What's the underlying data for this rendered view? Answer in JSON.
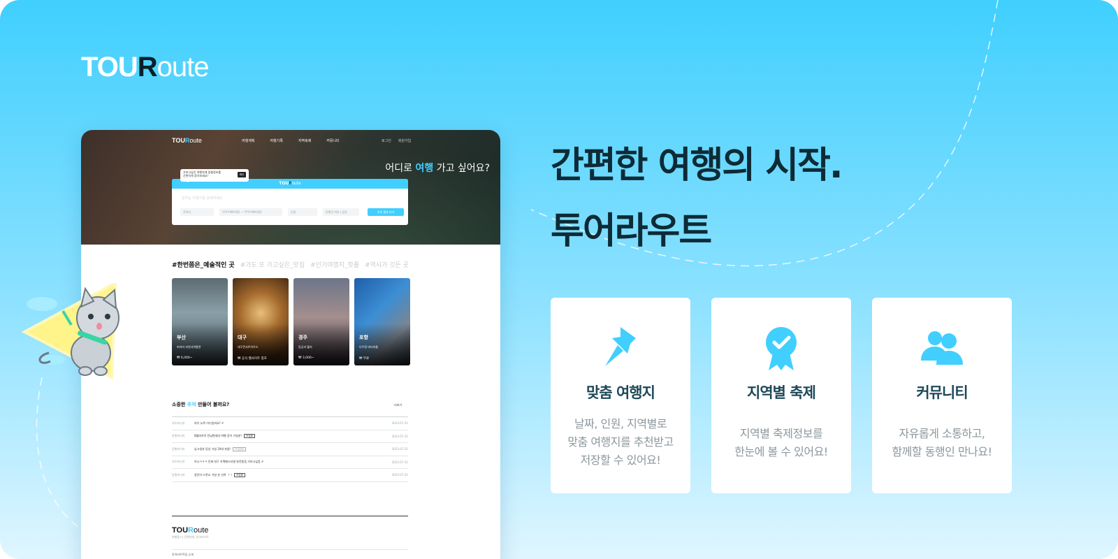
{
  "brand": {
    "tour": "TOU",
    "r": "R",
    "rest": "oute"
  },
  "mockup": {
    "nav": [
      "여행계획",
      "여행기록",
      "지역축제",
      "커뮤니티"
    ],
    "auth": [
      "로그인",
      "회원가입"
    ],
    "question": {
      "pre": "어디로 ",
      "highlight": "여행",
      "post": " 가고 싶어요?"
    },
    "tooltip": {
      "line1": "가보고싶은 여행지에 맞춤정보를",
      "line2": "간편하게 찾아보세요!",
      "close": "확인"
    },
    "search": {
      "placeholder": "원하는 여행지를 검색하세요",
      "fields": [
        "목적지",
        "YYYY-MM-DD ~ YYYY-MM-DD",
        "인원",
        "동행인 여부 | 없음"
      ],
      "button": "추천 결과 보기"
    },
    "tags": [
      "#한번쯤은_예술적인 곳",
      "#가도 또 가고싶은_맛집",
      "#인기여행지_핫플",
      "#역사가 깃든 곳"
    ],
    "cards": [
      {
        "city": "부산",
        "place": "피라미 자연사박물관",
        "price": "₩ 6,000~"
      },
      {
        "city": "대구",
        "place": "대구콘서트하우스",
        "price": "₩ 공식 웹사이트 참조"
      },
      {
        "city": "경주",
        "place": "동궁과 월지",
        "price": "₩ 3,000~"
      },
      {
        "city": "포항",
        "place": "다우정 바다마을",
        "price": "₩ 무료"
      }
    ],
    "board": {
      "title_pre": "소중한 ",
      "title_hl": "추억",
      "title_post": " 만들어 볼까요?",
      "more": "더보기",
      "rows": [
        {
          "cat": "자유게시판",
          "title": "여기 뉴욕 어디일까요? ✐",
          "badge": "",
          "date": "2023-07-31"
        },
        {
          "cat": "동행게시판",
          "title": "8월마지막 전남편세대 여행 같이 가실분!",
          "badge": "모집중",
          "date": "2023-07-31"
        },
        {
          "cat": "동행게시판",
          "title": "남고생과 동성 가실 20대 분들!",
          "badge": "모집완료",
          "date": "2023-07-31"
        },
        {
          "cat": "자유게시판",
          "title": "아니ㅋㅋㅋ 진짜 대구 치맥페스티벌 완전좋음 가보고싶음 ✐",
          "badge": "",
          "date": "2023-07-31"
        },
        {
          "cat": "동행게시판",
          "title": "광안리 드론쇼 가실 분 선착 ㄱㄱ",
          "badge": "모집중",
          "date": "2023-07-31"
        }
      ]
    },
    "footer": {
      "sub": "여행을 더 간편하게, 투어라우트",
      "about": "투어라우트팀 소개"
    }
  },
  "headline": {
    "line1": "간편한 여행의 시작.",
    "line2": "투어라우트"
  },
  "features": [
    {
      "icon": "pushpin-icon",
      "title": "맞춤 여행지",
      "desc": [
        "날짜, 인원, 지역별로",
        "맞춤 여행지를 추천받고",
        "저장할 수 있어요!"
      ]
    },
    {
      "icon": "badge-check-icon",
      "title": "지역별 축제",
      "desc": [
        "지역별 축제정보를",
        "한눈에 볼 수 있어요!"
      ]
    },
    {
      "icon": "people-icon",
      "title": "커뮤니티",
      "desc": [
        "자유롭게 소통하고,",
        "함께할 동행인 만나요!"
      ]
    }
  ],
  "colors": {
    "accent": "#40cffe",
    "headline": "#0d2b36",
    "feature_title": "#1d4858"
  }
}
